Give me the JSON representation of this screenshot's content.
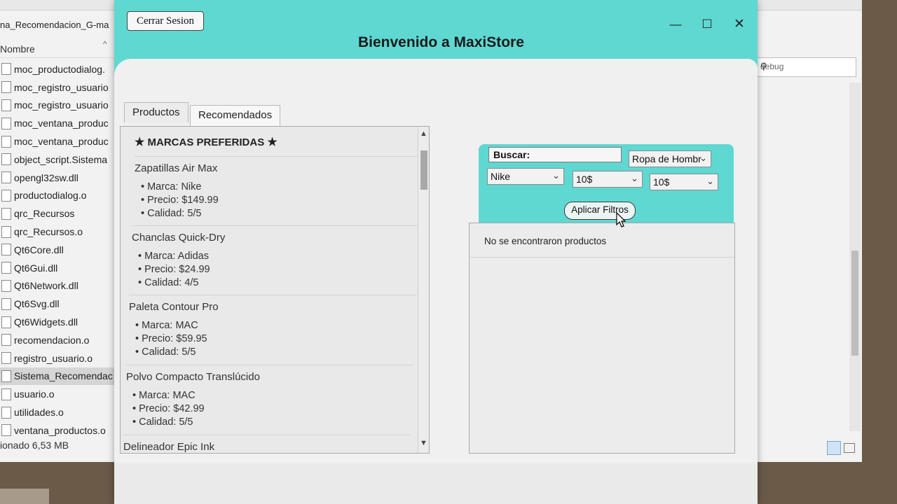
{
  "explorer": {
    "path_fragment": "na_Recomendacion_G-ma",
    "column_header": "Nombre",
    "files": [
      "moc_productodialog.",
      "moc_registro_usuario",
      "moc_registro_usuario",
      "moc_ventana_produc",
      "moc_ventana_produc",
      "object_script.Sistema",
      "opengl32sw.dll",
      "productodialog.o",
      "qrc_Recursos",
      "qrc_Recursos.o",
      "Qt6Core.dll",
      "Qt6Gui.dll",
      "Qt6Network.dll",
      "Qt6Svg.dll",
      "Qt6Widgets.dll",
      "recomendacion.o",
      "registro_usuario.o",
      "Sistema_Recomendac",
      "usuario.o",
      "utilidades.o",
      "ventana_productos.o"
    ],
    "selected_index": 17,
    "status_text": "ionado  6,53 MB",
    "search_fragment": "debug"
  },
  "app": {
    "logout_label": "Cerrar Sesion",
    "title": "Bienvenido a MaxiStore",
    "window_controls": {
      "minimize": "—",
      "maximize": "☐",
      "close": "✕"
    },
    "tabs": [
      {
        "label": "Productos"
      },
      {
        "label": "Recomendados",
        "active": true
      }
    ],
    "recommended": {
      "header_star_left": "★",
      "header_text": "MARCAS PREFERIDAS",
      "header_star_right": "★",
      "products": [
        {
          "name": "Zapatillas Air Max",
          "brand": "• Marca: Nike",
          "price": "• Precio: $149.99",
          "quality": "• Calidad: 5/5"
        },
        {
          "name": "Chanclas Quick-Dry",
          "brand": "• Marca: Adidas",
          "price": "• Precio: $24.99",
          "quality": "• Calidad: 4/5"
        },
        {
          "name": "Paleta Contour Pro",
          "brand": "• Marca: MAC",
          "price": "• Precio: $59.95",
          "quality": "• Calidad: 5/5"
        },
        {
          "name": "Polvo Compacto Translúcido",
          "brand": "• Marca: MAC",
          "price": "• Precio: $42.99",
          "quality": "• Calidad: 5/5"
        },
        {
          "name": "Delineador Epic Ink",
          "brand": "",
          "price": "",
          "quality": ""
        }
      ]
    },
    "filters": {
      "search_value": "Buscar:",
      "category": "Ropa de Hombr",
      "brand": "Nike",
      "min_price": "10$",
      "max_price": "10$",
      "apply_label": "Aplicar Filtros"
    },
    "results": {
      "empty_message": "No se encontraron productos"
    }
  },
  "colors": {
    "accent": "#5fd8d2",
    "window_bg": "#f0f0f0"
  }
}
